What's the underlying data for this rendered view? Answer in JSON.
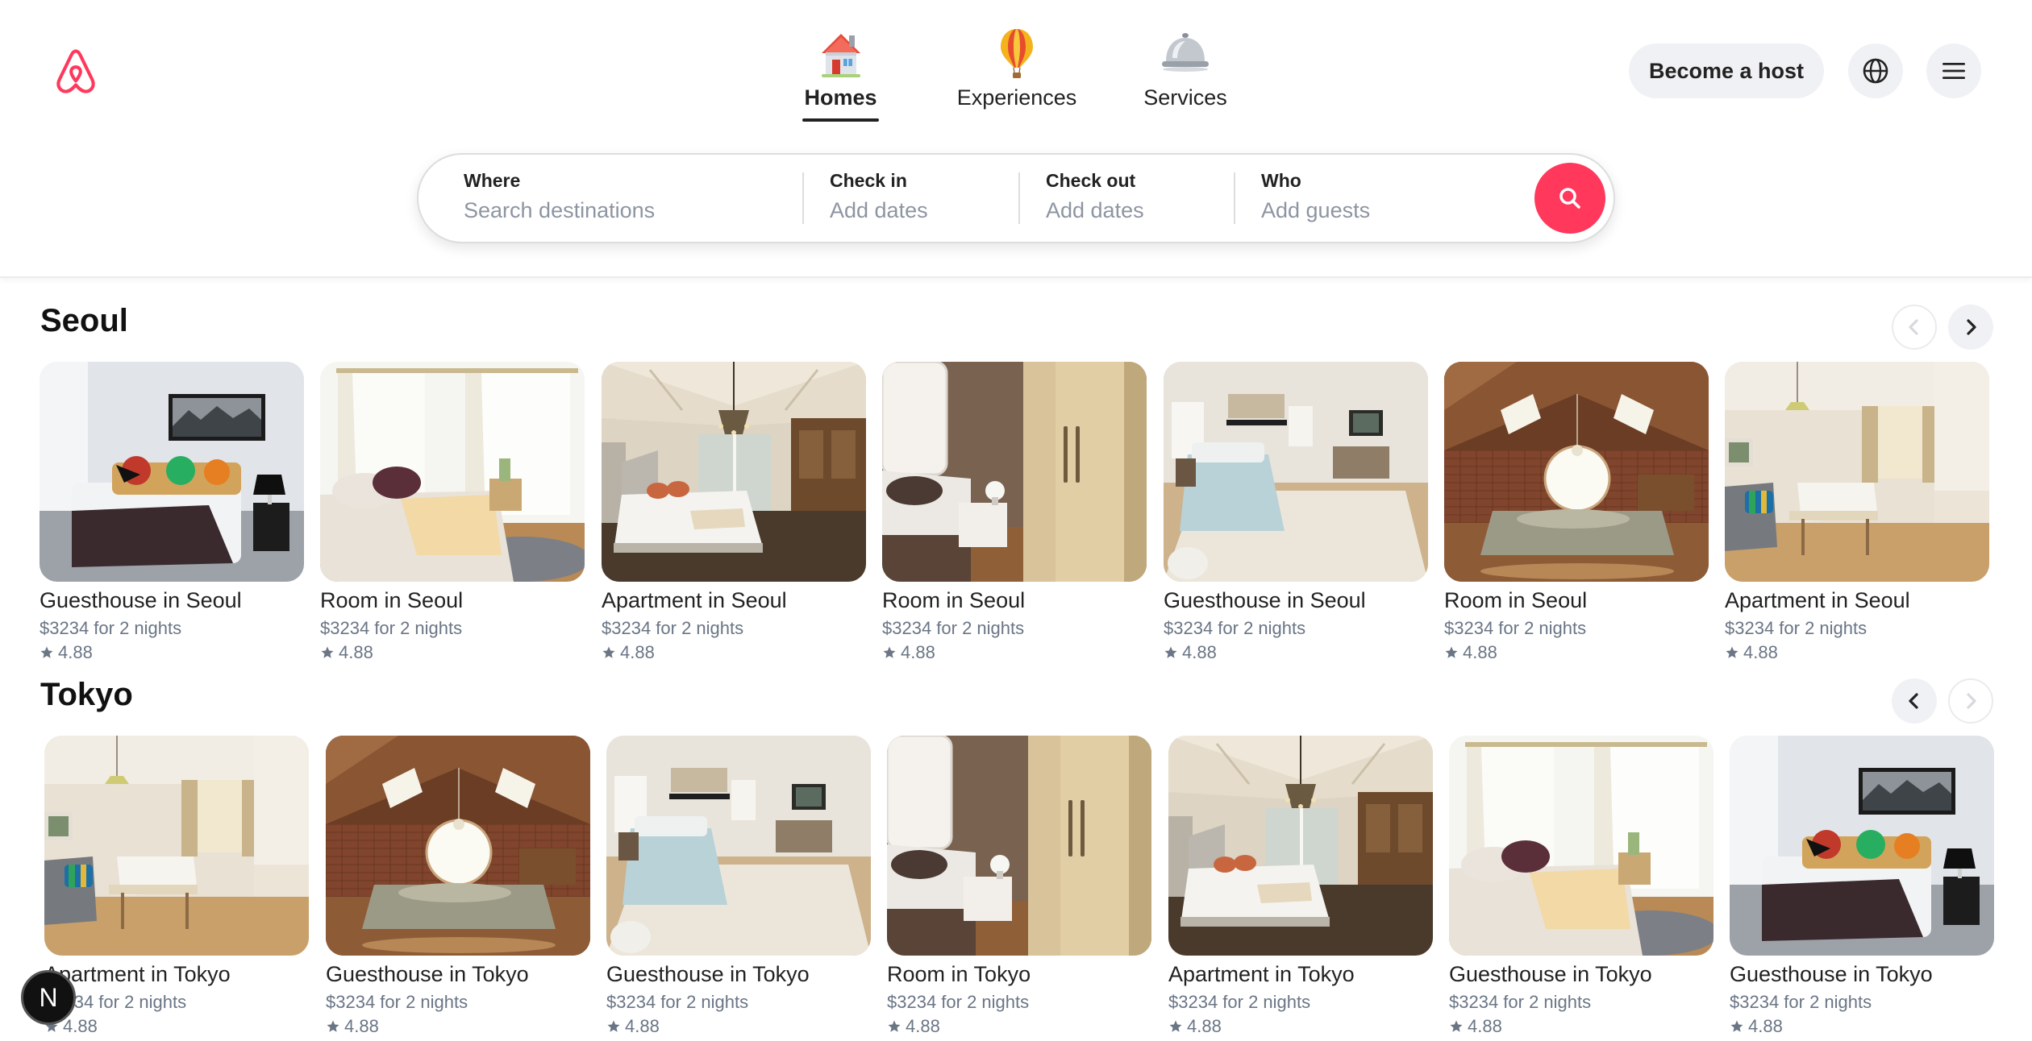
{
  "header": {
    "logo_icon": "airbnb-logo-icon",
    "brand_color": "#ff385c",
    "tabs": [
      {
        "label": "Homes",
        "icon": "house-icon",
        "active": true
      },
      {
        "label": "Experiences",
        "icon": "hot-air-balloon-icon",
        "active": false
      },
      {
        "label": "Services",
        "icon": "service-bell-icon",
        "active": false
      }
    ],
    "become_host_label": "Become a host",
    "globe_icon": "globe-icon",
    "menu_icon": "hamburger-menu-icon"
  },
  "search": {
    "where": {
      "label": "Where",
      "placeholder": "Search destinations"
    },
    "checkin": {
      "label": "Check in",
      "placeholder": "Add dates"
    },
    "checkout": {
      "label": "Check out",
      "placeholder": "Add dates"
    },
    "who": {
      "label": "Who",
      "placeholder": "Add guests"
    },
    "button_icon": "search-icon"
  },
  "sections": [
    {
      "title": "Seoul",
      "prev_enabled": false,
      "next_enabled": true,
      "listings": [
        {
          "title": "Guesthouse in Seoul",
          "price": "$3234 for 2 nights",
          "rating": "4.88",
          "scene": "white-bedroom-dark-throw"
        },
        {
          "title": "Room in Seoul",
          "price": "$3234 for 2 nights",
          "rating": "4.88",
          "scene": "bright-curtain-room"
        },
        {
          "title": "Apartment in Seoul",
          "price": "$3234 for 2 nights",
          "rating": "4.88",
          "scene": "chandelier-vaulted-room"
        },
        {
          "title": "Room in Seoul",
          "price": "$3234 for 2 nights",
          "rating": "4.88",
          "scene": "wardrobe-room"
        },
        {
          "title": "Guesthouse in Seoul",
          "price": "$3234 for 2 nights",
          "rating": "4.88",
          "scene": "beige-carpet-room"
        },
        {
          "title": "Room in Seoul",
          "price": "$3234 for 2 nights",
          "rating": "4.88",
          "scene": "attic-round-window"
        },
        {
          "title": "Apartment in Seoul",
          "price": "$3234 for 2 nights",
          "rating": "4.88",
          "scene": "pendant-lamp-room"
        }
      ]
    },
    {
      "title": "Tokyo",
      "prev_enabled": true,
      "next_enabled": false,
      "listings": [
        {
          "title": "Apartment in Tokyo",
          "price": "$3234 for 2 nights",
          "rating": "4.88",
          "scene": "pendant-lamp-room"
        },
        {
          "title": "Guesthouse in Tokyo",
          "price": "$3234 for 2 nights",
          "rating": "4.88",
          "scene": "attic-round-window"
        },
        {
          "title": "Guesthouse in Tokyo",
          "price": "$3234 for 2 nights",
          "rating": "4.88",
          "scene": "beige-carpet-room"
        },
        {
          "title": "Room in Tokyo",
          "price": "$3234 for 2 nights",
          "rating": "4.88",
          "scene": "wardrobe-room"
        },
        {
          "title": "Apartment in Tokyo",
          "price": "$3234 for 2 nights",
          "rating": "4.88",
          "scene": "chandelier-vaulted-room"
        },
        {
          "title": "Guesthouse in Tokyo",
          "price": "$3234 for 2 nights",
          "rating": "4.88",
          "scene": "bright-curtain-room"
        },
        {
          "title": "Guesthouse in Tokyo",
          "price": "$3234 for 2 nights",
          "rating": "4.88",
          "scene": "white-bedroom-dark-throw"
        }
      ]
    }
  ],
  "avatar_badge": {
    "letter": "N"
  },
  "icons": {
    "star": "star-icon",
    "prev": "chevron-left-icon",
    "next": "chevron-right-icon"
  }
}
